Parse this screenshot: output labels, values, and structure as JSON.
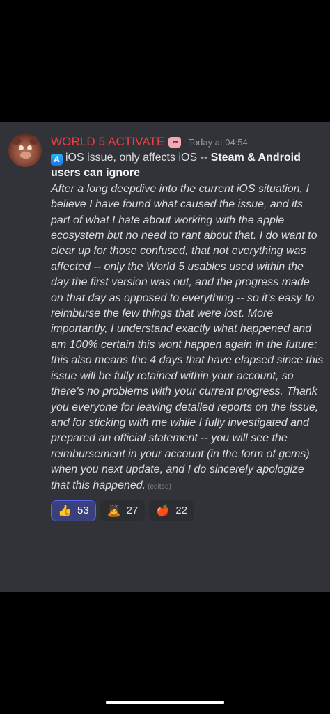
{
  "message": {
    "author": "WORLD 5 ACTIVATE",
    "timestamp": "Today at 04:54",
    "title_prefix": "iOS issue, only affects iOS -- ",
    "title_bold": "Steam & Android users can ignore",
    "body": "After a long deepdive into the current iOS situation, I believe I have found what caused the issue, and its part of what I hate about working with the apple ecosystem but no need to rant about that. I do want to clear up for those confused, that not everything was affected -- only the World 5 usables used within the day the first version was out, and the progress made on that day as opposed to everything -- so it's easy to reimburse the few things that were lost. More importantly, I understand exactly what happened and am 100% certain this wont happen again in the future; this also means the 4 days that have elapsed since this issue will be fully retained within your account, so there's no problems with your current progress. Thank you everyone for leaving detailed reports on the issue, and for sticking with me while I fully investigated and prepared an official statement -- you will see the reimbursement in your account (in the form of gems) when you next update, and I do sincerely apologize that this happened.",
    "edited_label": "(edited)",
    "role_icon": "pig-face-icon",
    "app_icon": "app-store-icon"
  },
  "reactions": [
    {
      "emoji": "👍",
      "icon": "thumbs-up-icon",
      "count": "53",
      "active": true
    },
    {
      "emoji": "🙇",
      "icon": "bowing-icon",
      "count": "27",
      "active": false
    },
    {
      "emoji": "🍎",
      "icon": "apple-icon",
      "count": "22",
      "active": false
    }
  ],
  "colors": {
    "username": "#f23f42",
    "card_bg": "#313338",
    "active_reaction": "#5865f2"
  }
}
